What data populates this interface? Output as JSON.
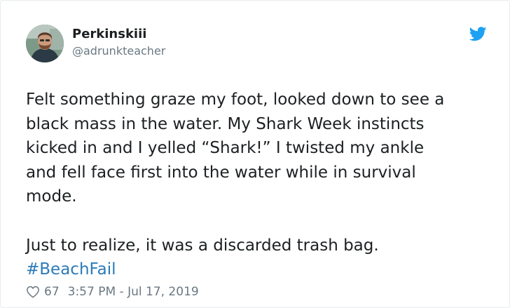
{
  "author": {
    "display_name": "Perkinskiii",
    "handle": "@adrunkteacher",
    "avatar_icon": "user-avatar-photo"
  },
  "brand": {
    "icon": "twitter-bird-icon",
    "color": "#1da1f2"
  },
  "tweet": {
    "lines": [
      "Felt something graze my foot, looked down to see a",
      "black mass in the water. My Shark Week instincts",
      "kicked in and I yelled “Shark!” I twisted my ankle",
      "and fell face first into the water while in survival",
      "mode."
    ],
    "closing_line": "Just to realize, it was a discarded trash bag.",
    "hashtag": "#BeachFail",
    "hashtag_color": "#2b7bb9"
  },
  "meta": {
    "like_icon": "heart-icon",
    "like_count": "67",
    "timestamp": "3:57 PM - Jul 17, 2019"
  }
}
